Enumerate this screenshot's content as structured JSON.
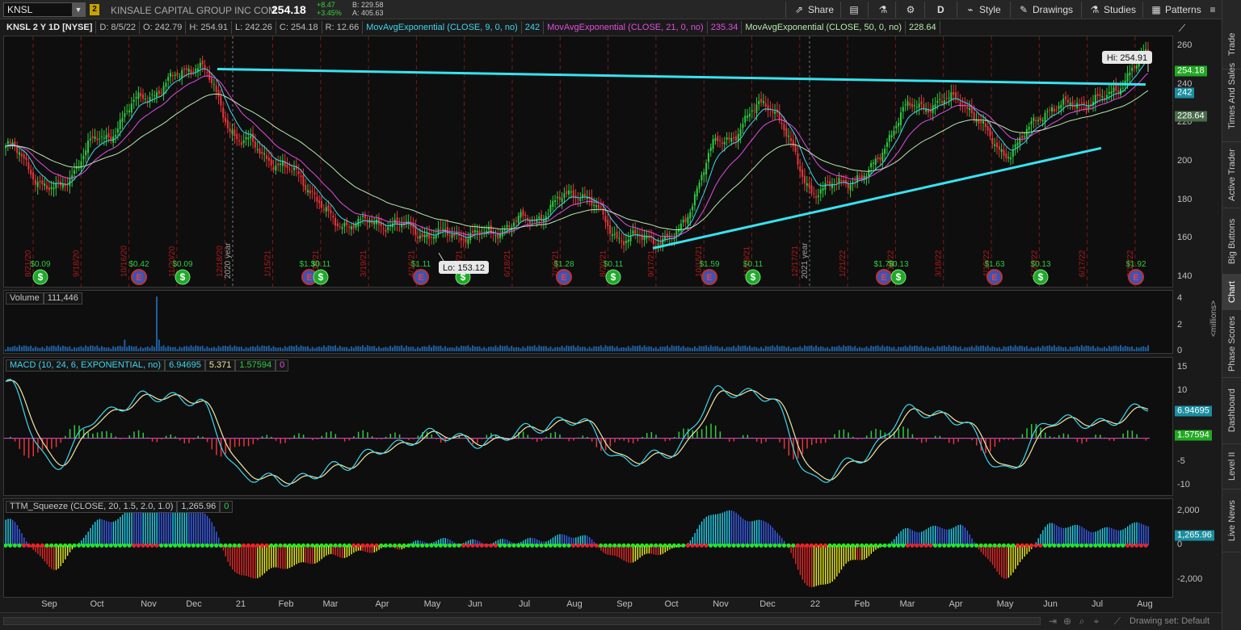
{
  "toolbar": {
    "symbol": "KNSL",
    "link_number": "2",
    "company": "KINSALE CAPITAL GROUP INC COM",
    "last": "254.18",
    "change": "+8.47",
    "change_pct": "+3.45%",
    "bid": "B: 229.58",
    "ask": "A: 405.63",
    "share_label": "Share",
    "aggregation_label": "D",
    "style_label": "Style",
    "drawings_label": "Drawings",
    "studies_label": "Studies",
    "patterns_label": "Patterns"
  },
  "header": {
    "symbol_desc": "KNSL 2 Y 1D [NYSE]",
    "date": "D: 8/5/22",
    "open": "O: 242.79",
    "high": "H: 254.91",
    "low": "L: 242.26",
    "close": "C: 254.18",
    "range": "R: 12.66",
    "ema9_label": "MovAvgExponential (CLOSE, 9, 0, no)",
    "ema9_value": "242",
    "ema21_label": "MovAvgExponential (CLOSE, 21, 0, no)",
    "ema21_value": "235.34",
    "ema50_label": "MovAvgExponential (CLOSE, 50, 0, no)",
    "ema50_value": "228.64"
  },
  "colors": {
    "up_candle": "#2ecc40",
    "down_candle": "#e8353a",
    "ema9": "#3fd6ee",
    "ema21": "#e04ee0",
    "ema50": "#b8e8b0",
    "trendline": "#37e3f0",
    "macd_line": "#3fd6ee",
    "macd_avg": "#f0e6a0",
    "squeeze_on": "#e8242a",
    "squeeze_off": "#22e822",
    "hist_blue": "#3a5ef0",
    "hist_yellow": "#f0f020",
    "hist_red": "#e82828"
  },
  "price_pane": {
    "hi_label": "Hi: 254.91",
    "lo_label": "Lo: 153.12",
    "last_flag": "254.18",
    "ema9_flag": "242",
    "ema50_flag": "228.64",
    "axis_ticks": [
      "260",
      "240",
      "220",
      "200",
      "180",
      "160",
      "140"
    ],
    "year_markers": [
      "2020 year",
      "2021 year"
    ],
    "date_markers": [
      "8/21/20",
      "9/18/20",
      "10/16/20",
      "11/20/20",
      "12/18/20",
      "1/15/21",
      "2/19/21",
      "3/19/21",
      "4/16/21",
      "5/21/21",
      "6/18/21",
      "7/16/21",
      "8/20/21",
      "9/17/21",
      "10/15/21",
      "11/19/21",
      "12/17/21",
      "1/21/22",
      "2/18/22",
      "3/18/22",
      "4/15/22",
      "5/20/22",
      "6/17/22",
      "7/15/22"
    ],
    "events": [
      {
        "label": "$0.09",
        "type": "dividend"
      },
      {
        "label": "$0.42",
        "type": "earnings"
      },
      {
        "label": "$0.09",
        "type": "dividend"
      },
      {
        "label": "$1.30",
        "type": "earnings"
      },
      {
        "label": "$0.11",
        "type": "dividend"
      },
      {
        "label": "$1.11",
        "type": "earnings"
      },
      {
        "label": "$0.11",
        "type": "dividend"
      },
      {
        "label": "$1.28",
        "type": "earnings"
      },
      {
        "label": "$0.11",
        "type": "dividend"
      },
      {
        "label": "$1.59",
        "type": "earnings"
      },
      {
        "label": "$0.11",
        "type": "dividend"
      },
      {
        "label": "$1.78",
        "type": "earnings"
      },
      {
        "label": "$0.13",
        "type": "dividend"
      },
      {
        "label": "$1.63",
        "type": "earnings"
      },
      {
        "label": "$0.13",
        "type": "dividend"
      },
      {
        "label": "$1.92",
        "type": "earnings"
      }
    ]
  },
  "volume_pane": {
    "title": "Volume",
    "value": "111,446",
    "axis_ticks": [
      "4",
      "2",
      "0"
    ],
    "unit_label": "<millions>"
  },
  "macd_pane": {
    "title": "MACD (10, 24, 6, EXPONENTIAL, no)",
    "value": "6.94695",
    "avg": "5.371",
    "diff": "1.57594",
    "extra": "0",
    "axis_ticks": [
      "15",
      "10",
      "5",
      "0",
      "-5",
      "-10"
    ],
    "value_flag": "6.94695",
    "diff_flag": "1.57594"
  },
  "squeeze_pane": {
    "title": "TTM_Squeeze (CLOSE, 20, 1.5, 2.0, 1.0)",
    "value": "1,265.96",
    "extra": "0",
    "axis_ticks": [
      "2,000",
      "0",
      "-2,000"
    ],
    "value_flag": "1,265.96"
  },
  "x_axis": [
    "Sep",
    "Oct",
    "Nov",
    "Dec",
    "21",
    "Feb",
    "Mar",
    "Apr",
    "May",
    "Jun",
    "Jul",
    "Aug",
    "Sep",
    "Oct",
    "Nov",
    "Dec",
    "22",
    "Feb",
    "Mar",
    "Apr",
    "May",
    "Jun",
    "Jul",
    "Aug"
  ],
  "sidebar": [
    "Trade",
    "Times And Sales",
    "Active Trader",
    "Big Buttons",
    "Chart",
    "Phase Scores",
    "Dashboard",
    "Level II",
    "Live News"
  ],
  "bottom": {
    "drawing_set": "Drawing set: Default"
  },
  "chart_data": {
    "type": "candlestick",
    "title": "KNSL 2 Y 1D [NYSE]",
    "x_range": [
      "Aug 2020",
      "Aug 2022"
    ],
    "ylim": [
      135,
      265
    ],
    "monthly_close": {
      "x": [
        "Aug 20",
        "Sep 20",
        "Oct 20",
        "Nov 20",
        "Dec 20",
        "Jan 21",
        "Feb 21",
        "Mar 21",
        "Apr 21",
        "May 21",
        "Jun 21",
        "Jul 21",
        "Aug 21",
        "Sep 21",
        "Oct 21",
        "Nov 21",
        "Dec 21",
        "Jan 22",
        "Feb 22",
        "Mar 22",
        "Apr 22",
        "May 22",
        "Jun 22",
        "Jul 22",
        "Aug 22"
      ],
      "y": [
        208,
        185,
        212,
        235,
        250,
        210,
        195,
        168,
        168,
        162,
        162,
        170,
        184,
        160,
        160,
        210,
        230,
        185,
        192,
        228,
        232,
        205,
        228,
        232,
        254.18
      ]
    },
    "series": [
      {
        "name": "MovAvgExponential (CLOSE, 9, 0, no)",
        "last": 242
      },
      {
        "name": "MovAvgExponential (CLOSE, 21, 0, no)",
        "last": 235.34
      },
      {
        "name": "MovAvgExponential (CLOSE, 50, 0, no)",
        "last": 228.64
      }
    ],
    "trendlines": [
      {
        "from": {
          "x": "Dec 18 2020",
          "y": 248
        },
        "to": {
          "x": "Aug 5 2022",
          "y": 240
        }
      },
      {
        "from": {
          "x": "Sep 2021",
          "y": 155
        },
        "to": {
          "x": "Jul 2022",
          "y": 207
        }
      }
    ],
    "high": 254.91,
    "low": 153.12,
    "macd_monthly": [
      12,
      -6,
      5,
      9,
      8,
      -8,
      -9,
      -6,
      -2,
      1,
      -1,
      2,
      4,
      -5,
      -3,
      10,
      9,
      -9,
      -4,
      6,
      4,
      -7,
      4,
      3,
      6.95
    ],
    "squeeze_monthly": [
      1500,
      -1300,
      1400,
      2200,
      2300,
      -1900,
      -1200,
      -600,
      -200,
      300,
      200,
      300,
      600,
      -900,
      -300,
      2000,
      1300,
      -2500,
      -700,
      900,
      1100,
      -1800,
      1200,
      900,
      1266
    ]
  }
}
